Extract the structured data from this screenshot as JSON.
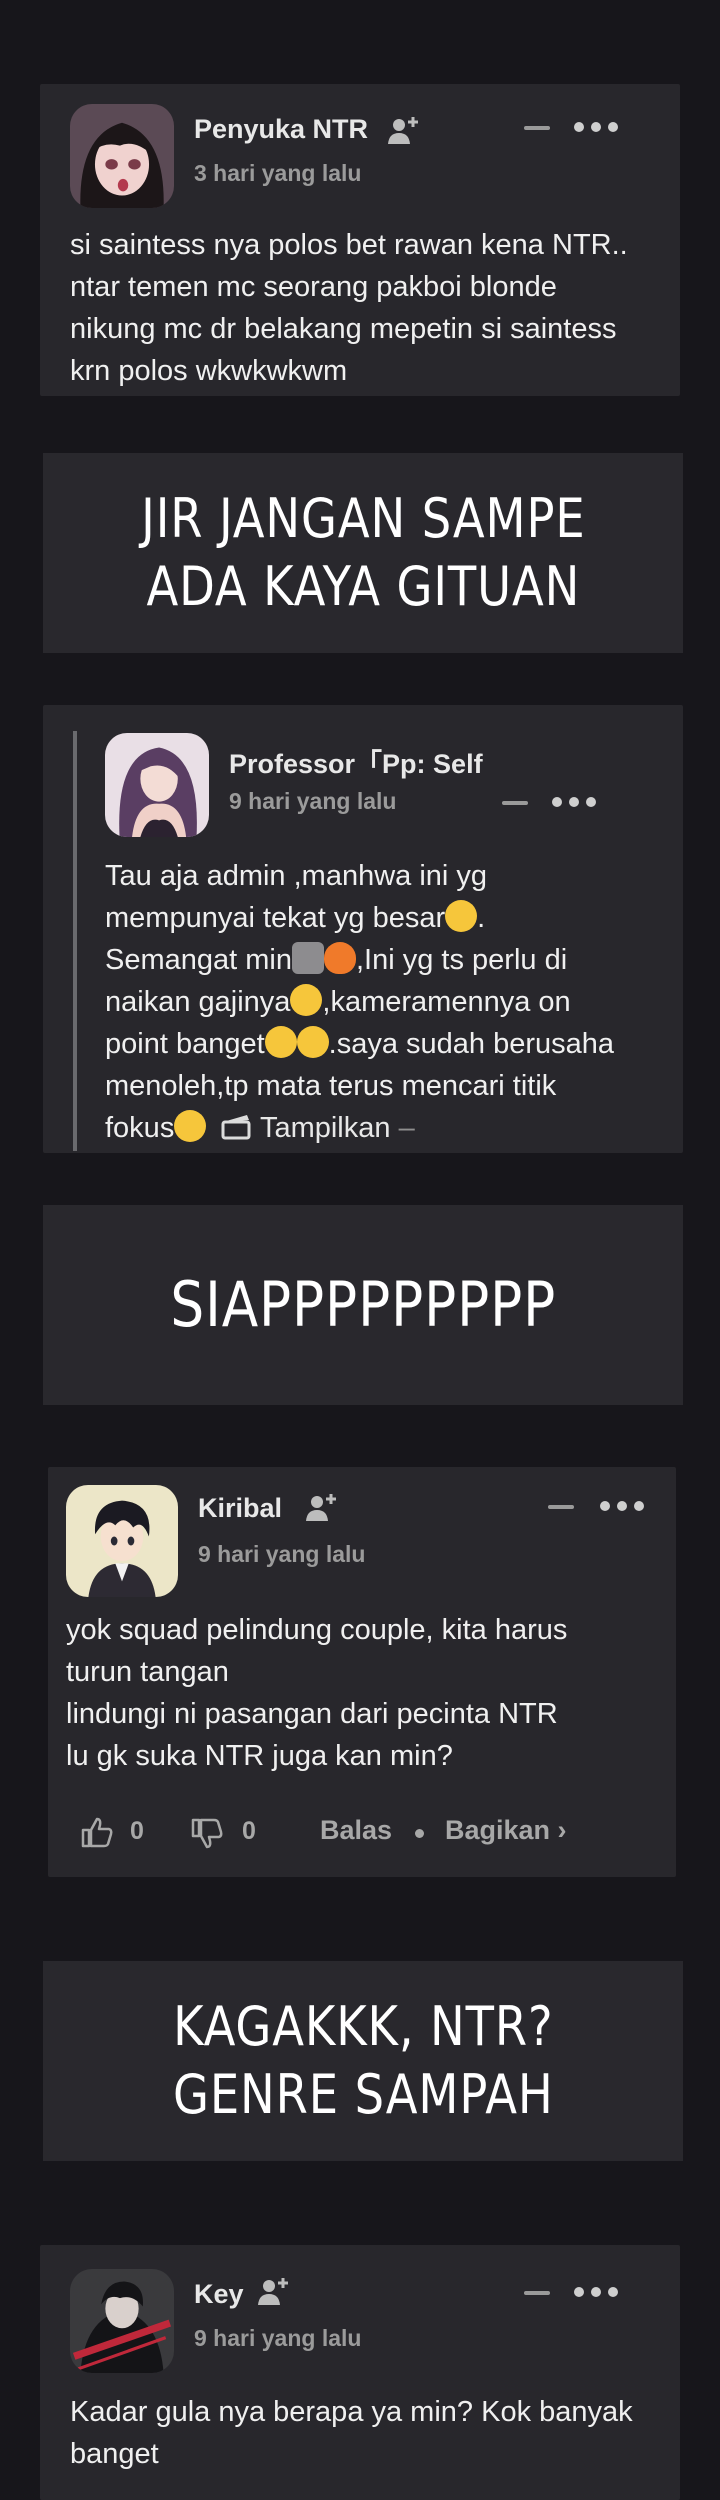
{
  "comments": [
    {
      "username": "Penyuka NTR",
      "time": "3 hari yang lalu",
      "lines": [
        "si saintess nya polos bet rawan kena NTR..",
        "ntar temen mc seorang pakboi blonde",
        "nikung mc dr belakang mepetin si saintess",
        "krn polos wkwkwkwm"
      ]
    },
    {
      "username": "Professor「Pp: Sel⁠f",
      "time": "9 hari yang lalu",
      "line1": "Tau aja admin ,manhwa ini yg",
      "line2": "mempunyai tekat yg besar",
      "line2_end": ".",
      "line3a": "Semangat min",
      "line3b": ",Ini yg ts perlu di",
      "line4a": "naikan gajinya",
      "line4b": ",kameramennya on",
      "line5a": "point banget",
      "line5b": ".saya sudah berusaha",
      "line6": "menoleh,tp mata terus mencari titik",
      "line7a": "fokus",
      "show_more": "Tampilkan",
      "show_more_suffix": "–"
    },
    {
      "username": "Kiribal",
      "time": "9 hari yang lalu",
      "lines": [
        "yok squad pelindung couple, kita harus",
        "turun tangan",
        "lindungi ni pasangan dari pecinta NTR",
        "lu gk suka NTR juga kan min?"
      ],
      "likes": "0",
      "dislikes": "0",
      "reply": "Balas",
      "share": "Bagikan ›"
    },
    {
      "username": "Key",
      "time": "9 hari yang lalu",
      "lines": [
        "Kadar gula nya berapa ya min? Kok banyak",
        "banget"
      ]
    }
  ],
  "captions": [
    {
      "lines": [
        "JIR JANGAN SAMPE",
        "ADA KAYA GITUAN"
      ]
    },
    {
      "lines": [
        "SIAPPPPPPPPP"
      ]
    },
    {
      "lines": [
        "KAGAKKK, NTR?",
        "GENRE SAMPAH"
      ]
    }
  ],
  "colors": {
    "background": "#17161b",
    "panel": "#28272c",
    "muted": "#9b9b9b",
    "text": "#f0f0f0"
  }
}
